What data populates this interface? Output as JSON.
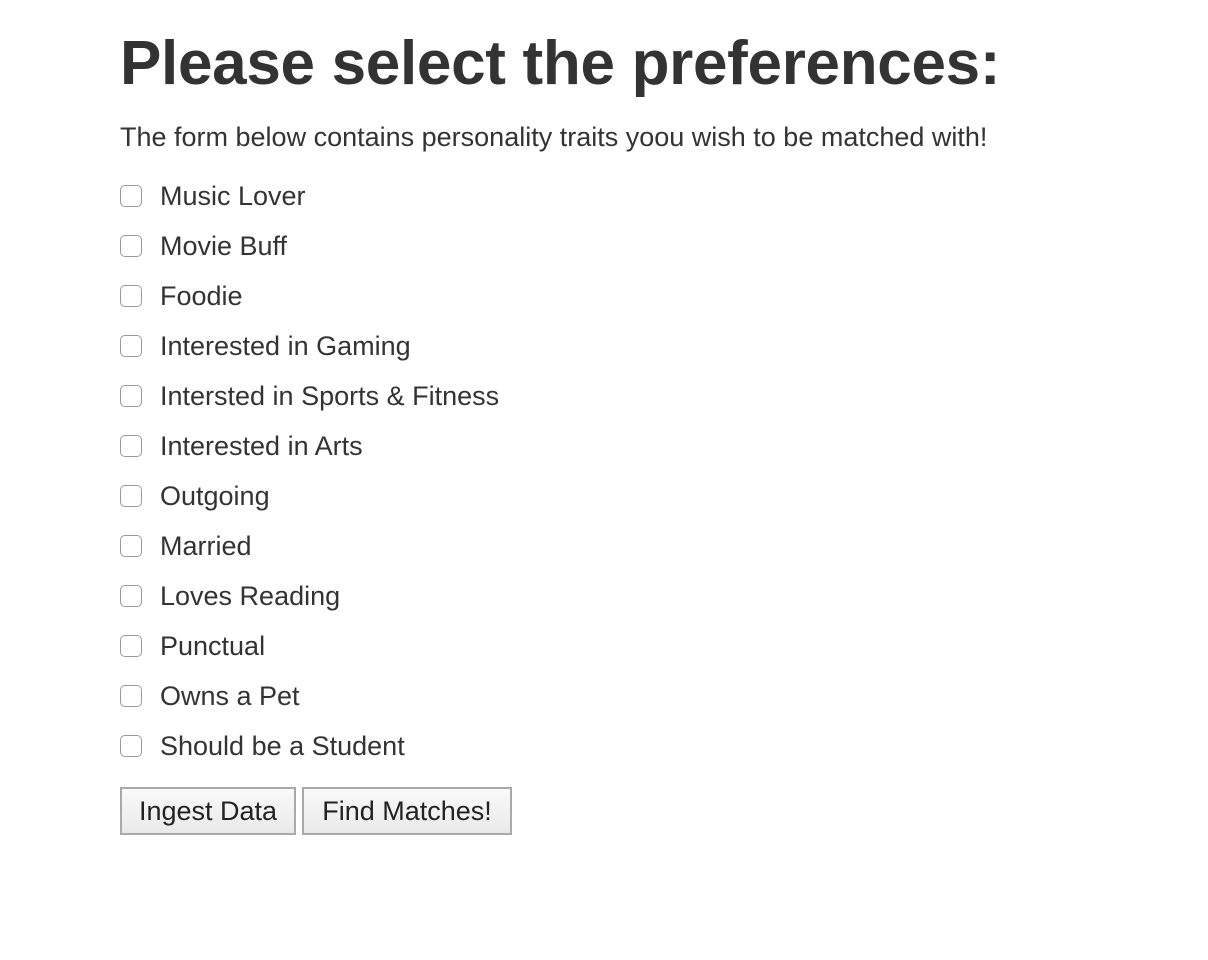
{
  "heading": "Please select the preferences:",
  "description": "The form below contains personality traits yoou wish to be matched with!",
  "preferences": [
    {
      "label": "Music Lover",
      "checked": false
    },
    {
      "label": "Movie Buff",
      "checked": false
    },
    {
      "label": "Foodie",
      "checked": false
    },
    {
      "label": "Interested in Gaming",
      "checked": false
    },
    {
      "label": "Intersted in Sports & Fitness",
      "checked": false
    },
    {
      "label": "Interested in Arts",
      "checked": false
    },
    {
      "label": "Outgoing",
      "checked": false
    },
    {
      "label": "Married",
      "checked": false
    },
    {
      "label": "Loves Reading",
      "checked": false
    },
    {
      "label": "Punctual",
      "checked": false
    },
    {
      "label": "Owns a Pet",
      "checked": false
    },
    {
      "label": "Should be a Student",
      "checked": false
    }
  ],
  "buttons": {
    "ingest_label": "Ingest Data",
    "find_label": "Find Matches!"
  },
  "colors": {
    "text": "#333333",
    "checkbox_border": "#9a9a9a",
    "button_border": "#a9a9a9"
  }
}
